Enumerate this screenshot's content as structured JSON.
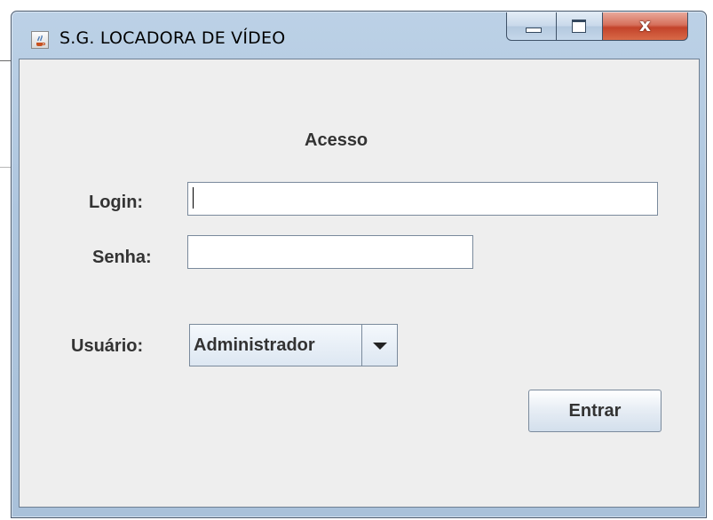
{
  "window": {
    "title": "S.G. LOCADORA DE VÍDEO",
    "icon": "java-cup-icon",
    "controls": {
      "minimize_icon": "minimize-icon",
      "maximize_icon": "maximize-icon",
      "close_icon": "close-icon",
      "close_glyph": "x"
    }
  },
  "form": {
    "heading": "Acesso",
    "login_label": "Login:",
    "login_value": "",
    "password_label": "Senha:",
    "password_value": "",
    "user_type_label": "Usuário:",
    "user_type_selected": "Administrador",
    "submit_label": "Entrar"
  },
  "colors": {
    "client_background": "#eeeeee",
    "text": "#333333",
    "close_button": "#c3432a"
  }
}
